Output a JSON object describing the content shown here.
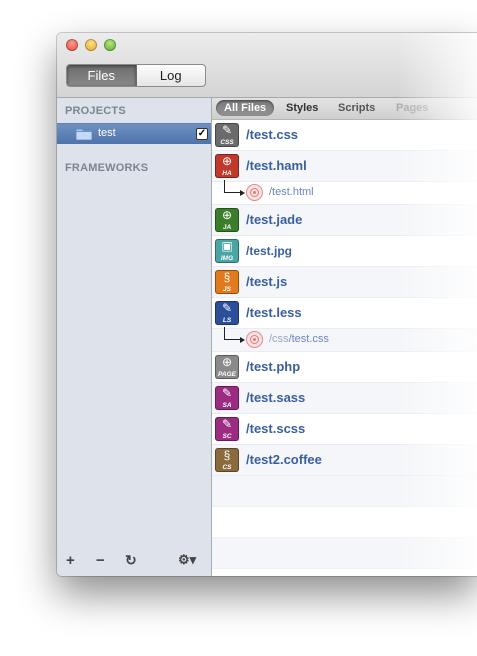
{
  "toolbar": {
    "tabs": [
      {
        "label": "Files",
        "active": true
      },
      {
        "label": "Log",
        "active": false
      }
    ]
  },
  "sidebar": {
    "projects_header": "PROJECTS",
    "project": {
      "name": "test",
      "checked": true
    },
    "frameworks_header": "FRAMEWORKS",
    "bottom": {
      "add": "+",
      "remove": "−",
      "refresh": "↻",
      "gear": "⚙▾"
    }
  },
  "filter_tabs": [
    {
      "label": "All Files",
      "active": true
    },
    {
      "label": "Styles"
    },
    {
      "label": "Scripts"
    },
    {
      "label": "Pages"
    }
  ],
  "files": [
    {
      "type": "file",
      "name": "/test.css",
      "icon": "CSS",
      "color": "#6b6b6b",
      "glyph": "✎"
    },
    {
      "type": "file",
      "name": "/test.haml",
      "icon": "HA",
      "color": "#c0392b",
      "glyph": "⊕"
    },
    {
      "type": "output",
      "prefix": "",
      "name": "/test.html"
    },
    {
      "type": "file",
      "name": "/test.jade",
      "icon": "JA",
      "color": "#3a7d2a",
      "glyph": "⊕"
    },
    {
      "type": "file",
      "name": "/test.jpg",
      "icon": "IMG",
      "color": "#4aa5a5",
      "glyph": "▣",
      "small": true
    },
    {
      "type": "file",
      "name": "/test.js",
      "icon": "JS",
      "color": "#e07a1c",
      "glyph": "§"
    },
    {
      "type": "file",
      "name": "/test.less",
      "icon": "LS",
      "color": "#2c4f9a",
      "glyph": "✎"
    },
    {
      "type": "output",
      "prefix": "/css",
      "name": "/test.css"
    },
    {
      "type": "file",
      "name": "/test.php",
      "icon": "PAGE",
      "color": "#8a8a8a",
      "glyph": "⊕"
    },
    {
      "type": "file",
      "name": "/test.sass",
      "icon": "SA",
      "color": "#9b2c82",
      "glyph": "✎"
    },
    {
      "type": "file",
      "name": "/test.scss",
      "icon": "SC",
      "color": "#9b2c82",
      "glyph": "✎"
    },
    {
      "type": "file",
      "name": "/test2.coffee",
      "icon": "CS",
      "color": "#8b6a3e",
      "glyph": "§"
    }
  ]
}
